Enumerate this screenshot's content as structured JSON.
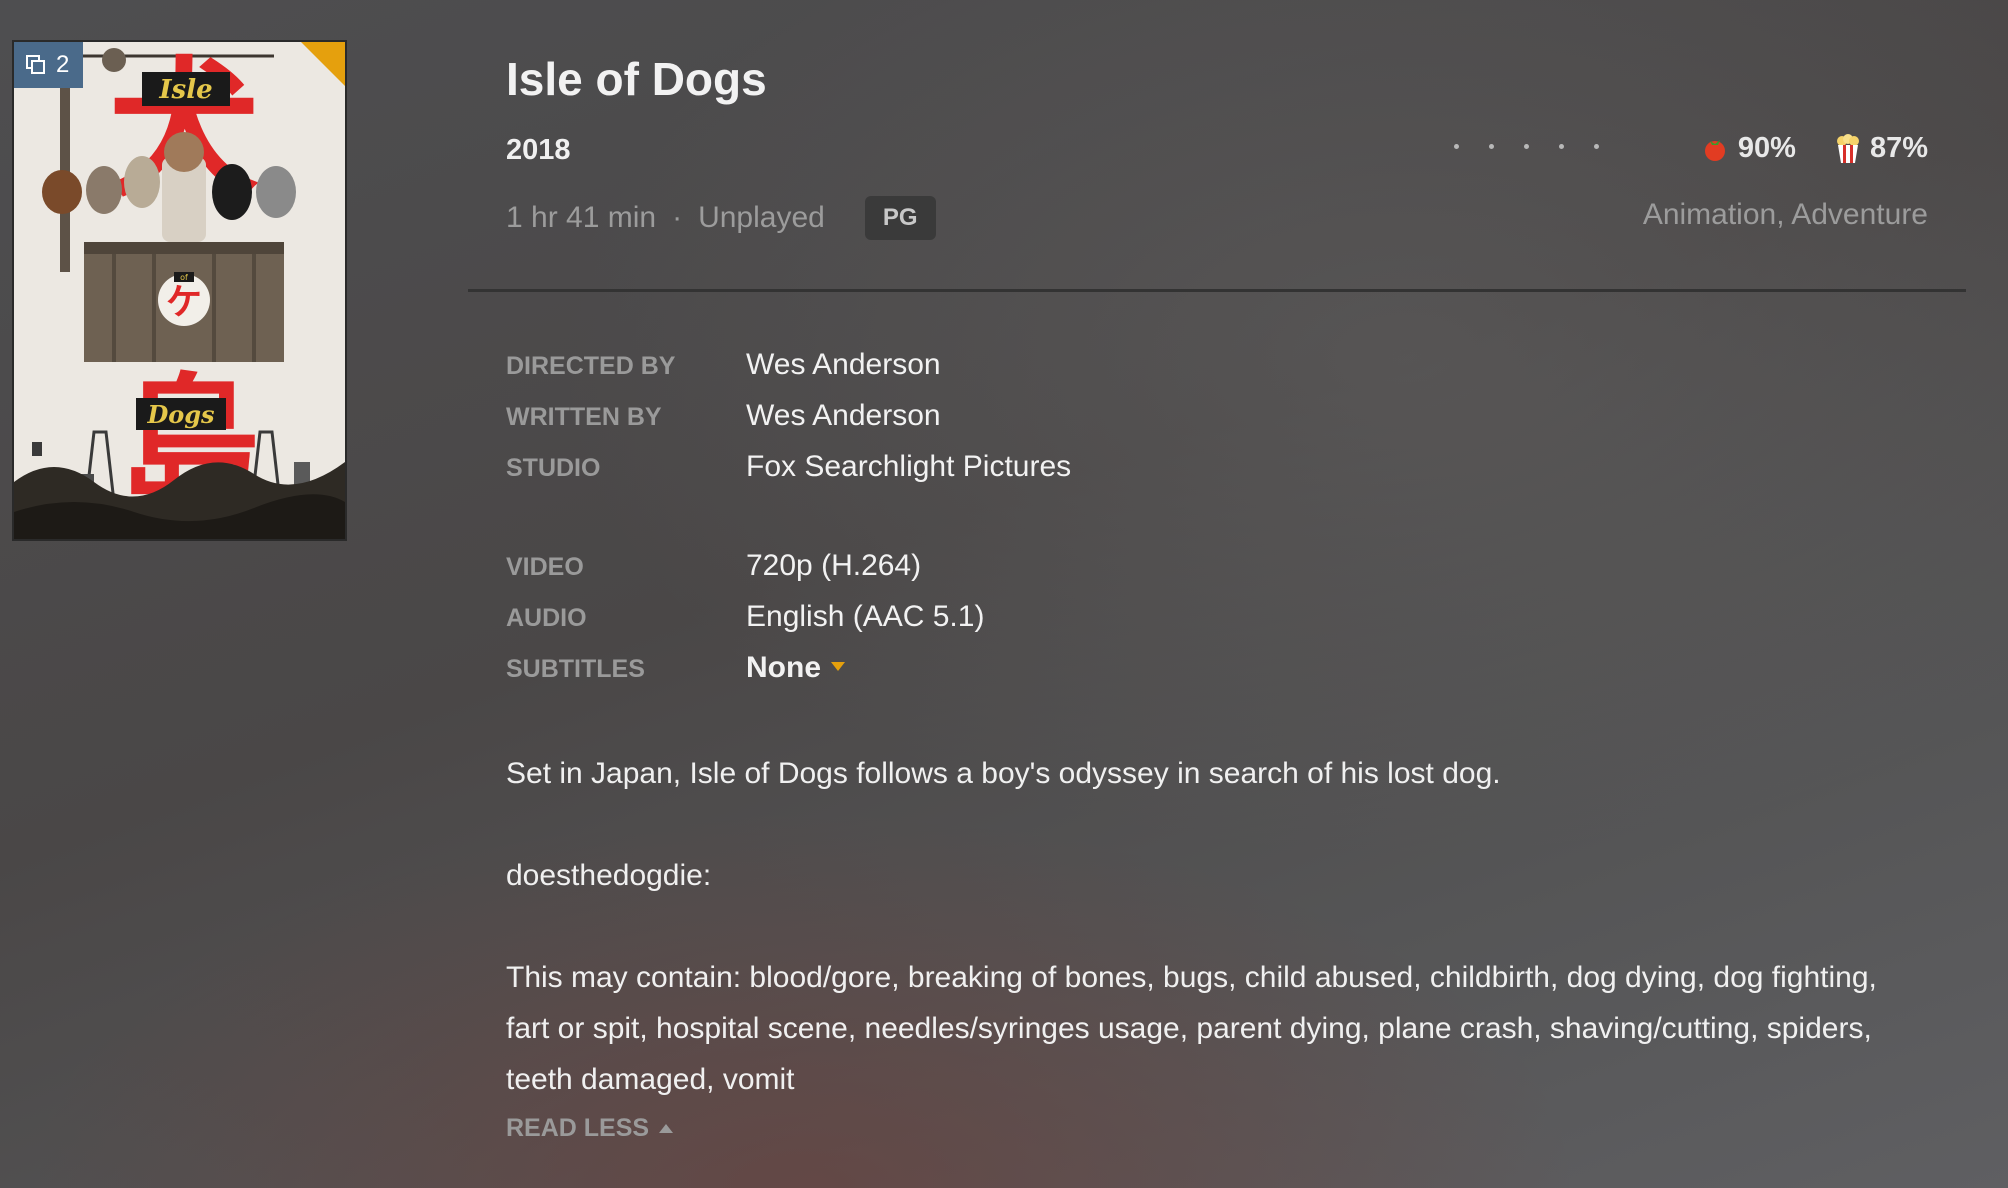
{
  "poster": {
    "version_count": "2",
    "version_icon": "versions-icon",
    "art_title_top": "Isle",
    "art_title_bottom": "Dogs",
    "art_of": "of",
    "art_kanji_top": "犬",
    "art_kanji_bottom": "島",
    "art_kana": "ケ"
  },
  "movie": {
    "title": "Isle of Dogs",
    "year": "2018",
    "duration": "1 hr 41 min",
    "separator": "·",
    "watch_status": "Unplayed",
    "content_rating": "PG",
    "genres": "Animation, Adventure"
  },
  "user_rating": {
    "stars_total": 5,
    "stars_filled": 0
  },
  "scores": {
    "critic_icon": "tomato-icon",
    "critic": "90%",
    "audience_icon": "popcorn-icon",
    "audience": "87%"
  },
  "credits": {
    "directed_by_label": "DIRECTED BY",
    "directed_by": "Wes Anderson",
    "written_by_label": "WRITTEN BY",
    "written_by": "Wes Anderson",
    "studio_label": "STUDIO",
    "studio": "Fox Searchlight Pictures"
  },
  "media": {
    "video_label": "VIDEO",
    "video": "720p (H.264)",
    "audio_label": "AUDIO",
    "audio": "English (AAC 5.1)",
    "subtitles_label": "SUBTITLES",
    "subtitles": "None"
  },
  "summary": {
    "paragraph1": "Set in Japan, Isle of Dogs follows a boy's odyssey in search of his lost dog.",
    "paragraph2": "doesthedogdie:",
    "paragraph3": "This may contain: blood/gore, breaking of bones, bugs, child abused, childbirth, dog dying, dog fighting, fart or spit, hospital scene, needles/syringes usage, parent dying, plane crash, shaving/cutting, spiders, teeth damaged, vomit",
    "read_less": "READ LESS"
  },
  "colors": {
    "accent": "#e5a00d",
    "badge_blue": "#4a6a8a",
    "label_gray": "#9a9a9a"
  }
}
